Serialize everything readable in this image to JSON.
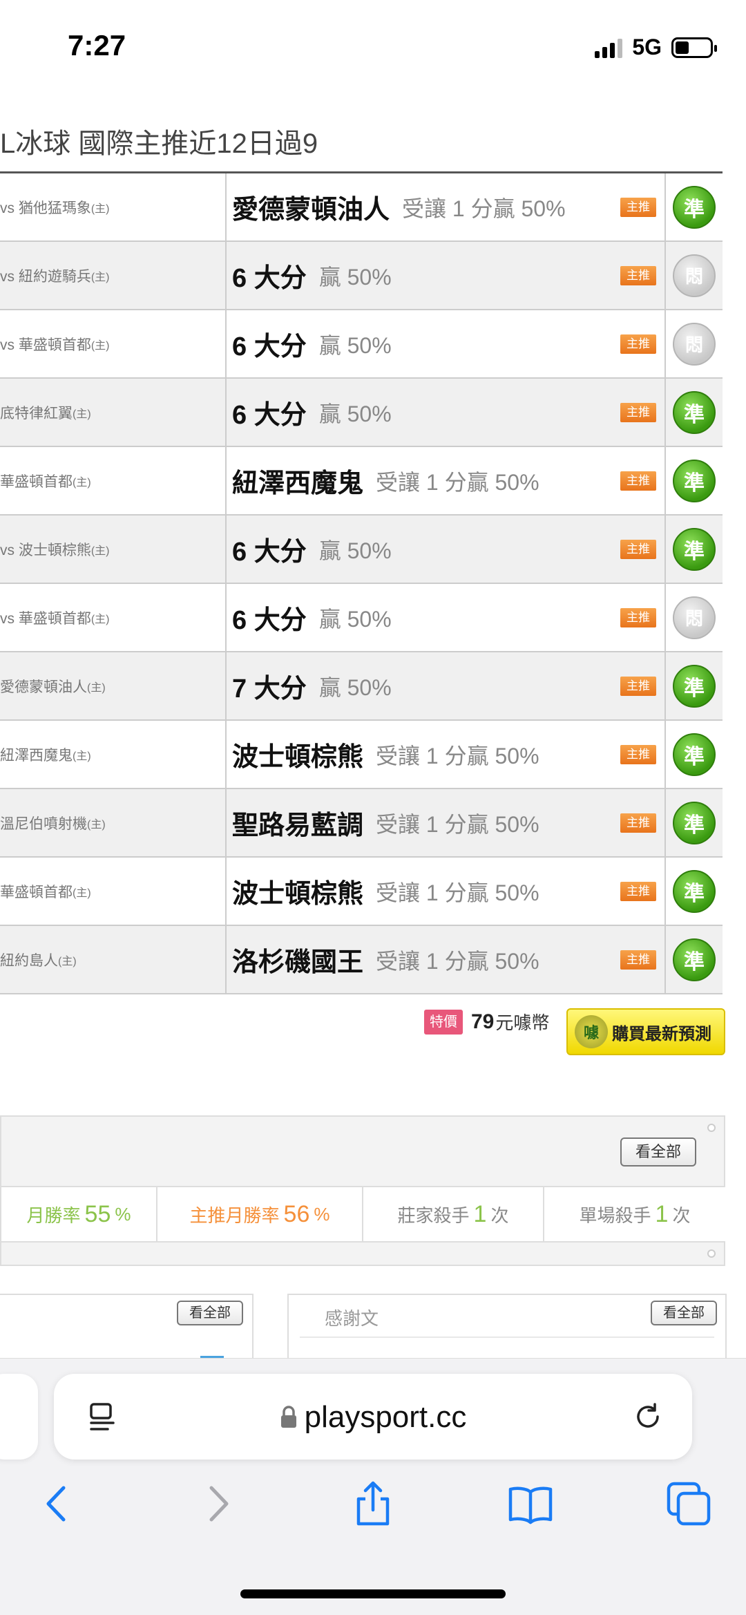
{
  "status": {
    "time": "7:27",
    "network": "5G"
  },
  "title": "L冰球 國際主推近12日過9",
  "rows": [
    {
      "match": "vs 猶他猛瑪象",
      "host": "(主)",
      "pick": "愛德蒙頓油人",
      "sub": "受讓 1 分贏 50%",
      "tag": "主推",
      "result": "準",
      "res_type": "hit"
    },
    {
      "match": "vs 紐約遊騎兵",
      "host": "(主)",
      "pick": "6 大分",
      "sub": "贏 50%",
      "tag": "主推",
      "result": "悶",
      "res_type": "push"
    },
    {
      "match": "vs 華盛頓首都",
      "host": "(主)",
      "pick": "6 大分",
      "sub": "贏 50%",
      "tag": "主推",
      "result": "悶",
      "res_type": "push"
    },
    {
      "match": "底特律紅翼",
      "host": "(主)",
      "pick": "6 大分",
      "sub": "贏 50%",
      "tag": "主推",
      "result": "準",
      "res_type": "hit"
    },
    {
      "match": "華盛頓首都",
      "host": "(主)",
      "pick": "紐澤西魔鬼",
      "sub": "受讓 1 分贏 50%",
      "tag": "主推",
      "result": "準",
      "res_type": "hit"
    },
    {
      "match": "vs 波士頓棕熊",
      "host": "(主)",
      "pick": "6 大分",
      "sub": "贏 50%",
      "tag": "主推",
      "result": "準",
      "res_type": "hit"
    },
    {
      "match": "vs 華盛頓首都",
      "host": "(主)",
      "pick": "6 大分",
      "sub": "贏 50%",
      "tag": "主推",
      "result": "悶",
      "res_type": "push"
    },
    {
      "match": "愛德蒙頓油人",
      "host": "(主)",
      "pick": "7 大分",
      "sub": "贏 50%",
      "tag": "主推",
      "result": "準",
      "res_type": "hit"
    },
    {
      "match": "紐澤西魔鬼",
      "host": "(主)",
      "pick": "波士頓棕熊",
      "sub": "受讓 1 分贏 50%",
      "tag": "主推",
      "result": "準",
      "res_type": "hit"
    },
    {
      "match": "溫尼伯噴射機",
      "host": "(主)",
      "pick": "聖路易藍調",
      "sub": "受讓 1 分贏 50%",
      "tag": "主推",
      "result": "準",
      "res_type": "hit"
    },
    {
      "match": "華盛頓首都",
      "host": "(主)",
      "pick": "波士頓棕熊",
      "sub": "受讓 1 分贏 50%",
      "tag": "主推",
      "result": "準",
      "res_type": "hit"
    },
    {
      "match": "紐約島人",
      "host": "(主)",
      "pick": "洛杉磯國王",
      "sub": "受讓 1 分贏 50%",
      "tag": "主推",
      "result": "準",
      "res_type": "hit"
    }
  ],
  "promo": {
    "badge": "特價",
    "amount": "79",
    "unit": "元噱幣",
    "buy_label": "購買最新預測",
    "buy_icon_text": "噱"
  },
  "stats": {
    "see_all": "看全部",
    "items": [
      {
        "label": "月勝率",
        "value": "55",
        "suffix": "%",
        "color": "green"
      },
      {
        "label": "主推月勝率",
        "value": "56",
        "suffix": "%",
        "color": "orange"
      },
      {
        "label": "莊家殺手",
        "value": "1",
        "suffix": "次",
        "color": "green"
      },
      {
        "label": "單場殺手",
        "value": "1",
        "suffix": "次",
        "color": "green"
      }
    ]
  },
  "boxes": {
    "left_see_all": "看全部",
    "right_title": "感謝文",
    "right_see_all": "看全部"
  },
  "browser": {
    "url": "playsport.cc"
  },
  "colors": {
    "hit_green": "#3a9a10",
    "tag_orange": "#e8741c",
    "promo_pink": "#e8577a",
    "buy_yellow": "#f0d800"
  },
  "icons": [
    "reader-icon",
    "lock-icon",
    "reload-icon",
    "back-icon",
    "forward-icon",
    "share-icon",
    "bookmarks-icon",
    "tabs-icon"
  ]
}
